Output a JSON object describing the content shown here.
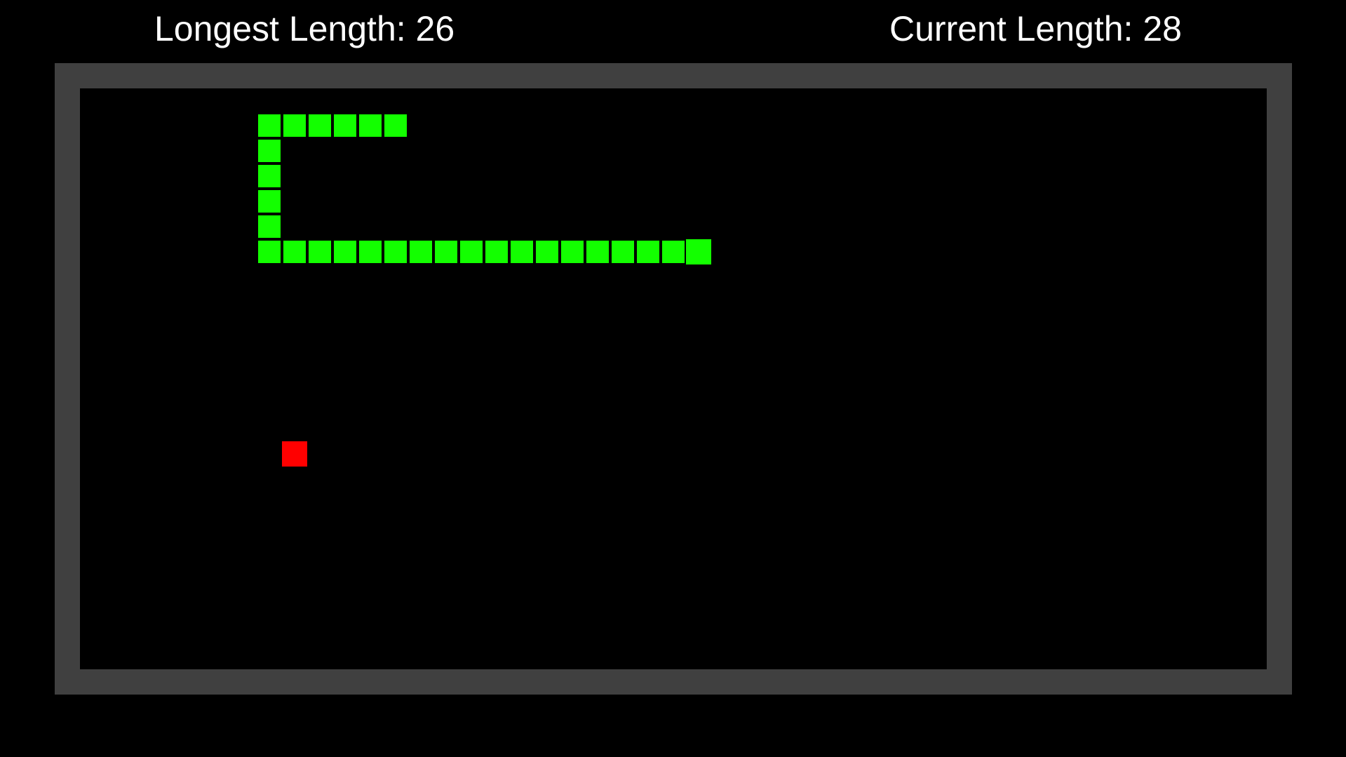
{
  "hud": {
    "longest_label": "Longest Length: 26",
    "current_label": "Current Length: 28"
  },
  "game": {
    "longest_length": 26,
    "current_length": 28,
    "grid_columns": 47,
    "grid_rows": 23,
    "snake": {
      "head": [
        17,
        5
      ],
      "body": [
        [
          16,
          5
        ],
        [
          15,
          5
        ],
        [
          14,
          5
        ],
        [
          13,
          5
        ],
        [
          12,
          5
        ],
        [
          11,
          5
        ],
        [
          10,
          5
        ],
        [
          9,
          5
        ],
        [
          8,
          5
        ],
        [
          7,
          5
        ],
        [
          6,
          5
        ],
        [
          5,
          5
        ],
        [
          4,
          5
        ],
        [
          3,
          5
        ],
        [
          2,
          5
        ],
        [
          1,
          5
        ],
        [
          0,
          5
        ],
        [
          0,
          4
        ],
        [
          0,
          3
        ],
        [
          0,
          2
        ],
        [
          0,
          1
        ],
        [
          0,
          0
        ],
        [
          1,
          0
        ],
        [
          2,
          0
        ],
        [
          3,
          0
        ],
        [
          4,
          0
        ],
        [
          5,
          0
        ]
      ]
    },
    "food": [
      1,
      13
    ]
  },
  "colors": {
    "background": "#000000",
    "border": "#404040",
    "snake": "#13ff00",
    "food": "#ff0000",
    "text": "#ffffff"
  }
}
